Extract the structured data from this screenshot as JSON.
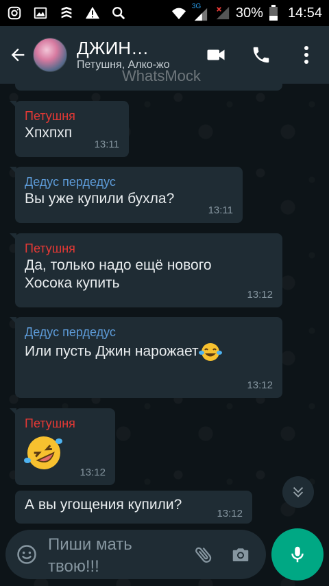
{
  "status_bar": {
    "battery": "30%",
    "time": "14:54",
    "network": "3G",
    "icons": [
      "instagram-icon",
      "gallery-icon",
      "vpn-icon",
      "warning-icon",
      "search-icon",
      "wifi-icon",
      "signal-icon",
      "no-signal-icon",
      "battery-icon"
    ]
  },
  "header": {
    "title": "ДЖИН…",
    "subtitle": "Петушня, Алко-жо",
    "watermark": "WhatsMock",
    "icons": [
      "back-arrow-icon",
      "video-call-icon",
      "phone-icon",
      "more-vert-icon"
    ]
  },
  "colors": {
    "header_bg": "#1f2c34",
    "bubble_bg": "#1f2c34",
    "sender_red": "#e53935",
    "sender_blue": "#5d9bd8",
    "accent_green": "#00a884",
    "time_text": "#8696a0"
  },
  "messages": [
    {
      "sender": "Петушня",
      "text": "Хпхпхп",
      "time": "13:11"
    },
    {
      "sender": "Дедус пердедус",
      "text": "Вы уже купили бухла?",
      "time": "13:11"
    },
    {
      "sender": "Петушня",
      "text_line1": "Да, только надо ещё нового",
      "text_line2": "Хосока купить",
      "time": "13:12"
    },
    {
      "sender": "Дедус пердедус",
      "text": "Или пусть Джин нарожает",
      "emoji": "tears-of-joy-emoji",
      "time": "13:12"
    },
    {
      "sender": "Петушня",
      "emoji": "rofl-emoji",
      "time": "13:12"
    },
    {
      "text": "А вы угощения купили?",
      "time": "13:12"
    }
  ],
  "input": {
    "placeholder_line1": "Пиши мать",
    "placeholder_line2": "твою!!!",
    "icons": [
      "emoji-icon",
      "attach-icon",
      "camera-icon",
      "mic-icon"
    ]
  }
}
